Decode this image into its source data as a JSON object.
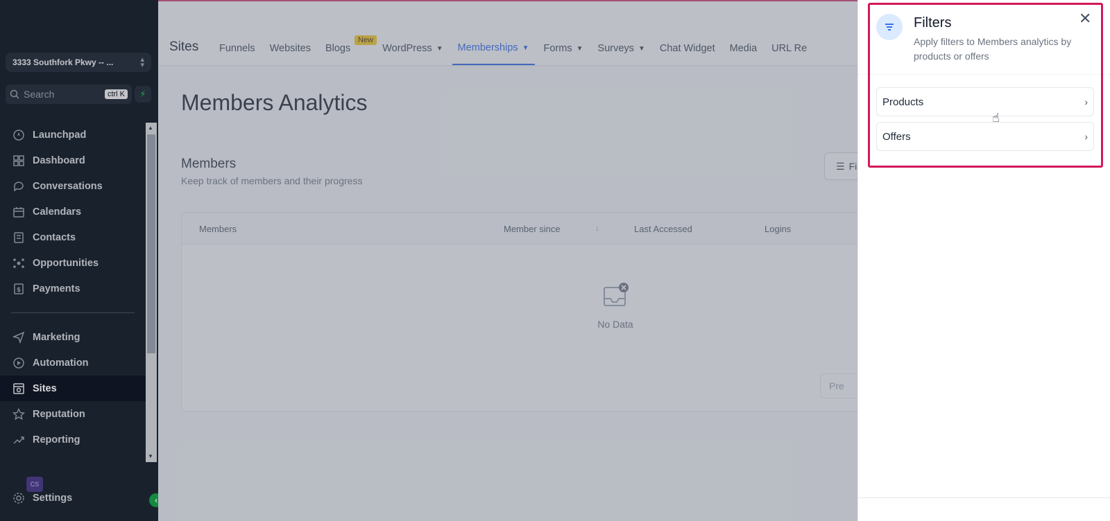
{
  "sidebar": {
    "location": "3333 Southfork Pkwy -- ...",
    "search_placeholder": "Search",
    "search_shortcut": "ctrl K",
    "items": [
      {
        "label": "Launchpad",
        "icon": "rocket-icon"
      },
      {
        "label": "Dashboard",
        "icon": "grid-icon"
      },
      {
        "label": "Conversations",
        "icon": "chat-icon"
      },
      {
        "label": "Calendars",
        "icon": "calendar-icon"
      },
      {
        "label": "Contacts",
        "icon": "contacts-icon"
      },
      {
        "label": "Opportunities",
        "icon": "opportunities-icon"
      },
      {
        "label": "Payments",
        "icon": "payments-icon"
      }
    ],
    "items2": [
      {
        "label": "Marketing",
        "icon": "send-icon"
      },
      {
        "label": "Automation",
        "icon": "automation-icon"
      },
      {
        "label": "Sites",
        "icon": "sites-icon"
      },
      {
        "label": "Reputation",
        "icon": "star-icon"
      },
      {
        "label": "Reporting",
        "icon": "trend-icon"
      }
    ],
    "settings_label": "Settings",
    "avatar_text": "CS"
  },
  "topbar": {
    "title": "Sites",
    "tabs": [
      {
        "label": "Funnels"
      },
      {
        "label": "Websites"
      },
      {
        "label": "Blogs",
        "badge": "New"
      },
      {
        "label": "WordPress"
      },
      {
        "label": "Memberships"
      },
      {
        "label": "Forms"
      },
      {
        "label": "Surveys"
      },
      {
        "label": "Chat Widget"
      },
      {
        "label": "Media"
      },
      {
        "label": "URL Re"
      }
    ]
  },
  "main": {
    "page_title": "Members Analytics",
    "section_title": "Members",
    "section_subtitle": "Keep track of members and their progress",
    "filter_button": "Fi",
    "columns": [
      "Members",
      "Member since",
      "Last Accessed",
      "Logins"
    ],
    "empty_text": "No Data",
    "prev_button": "Pre"
  },
  "drawer": {
    "title": "Filters",
    "subtitle": "Apply filters to Members analytics by products or offers",
    "options": [
      {
        "label": "Products"
      },
      {
        "label": "Offers"
      }
    ]
  },
  "colors": {
    "sidebar_bg": "#1e2735",
    "accent": "#2563eb",
    "highlight": "#d1195a",
    "badge": "#facc15"
  }
}
